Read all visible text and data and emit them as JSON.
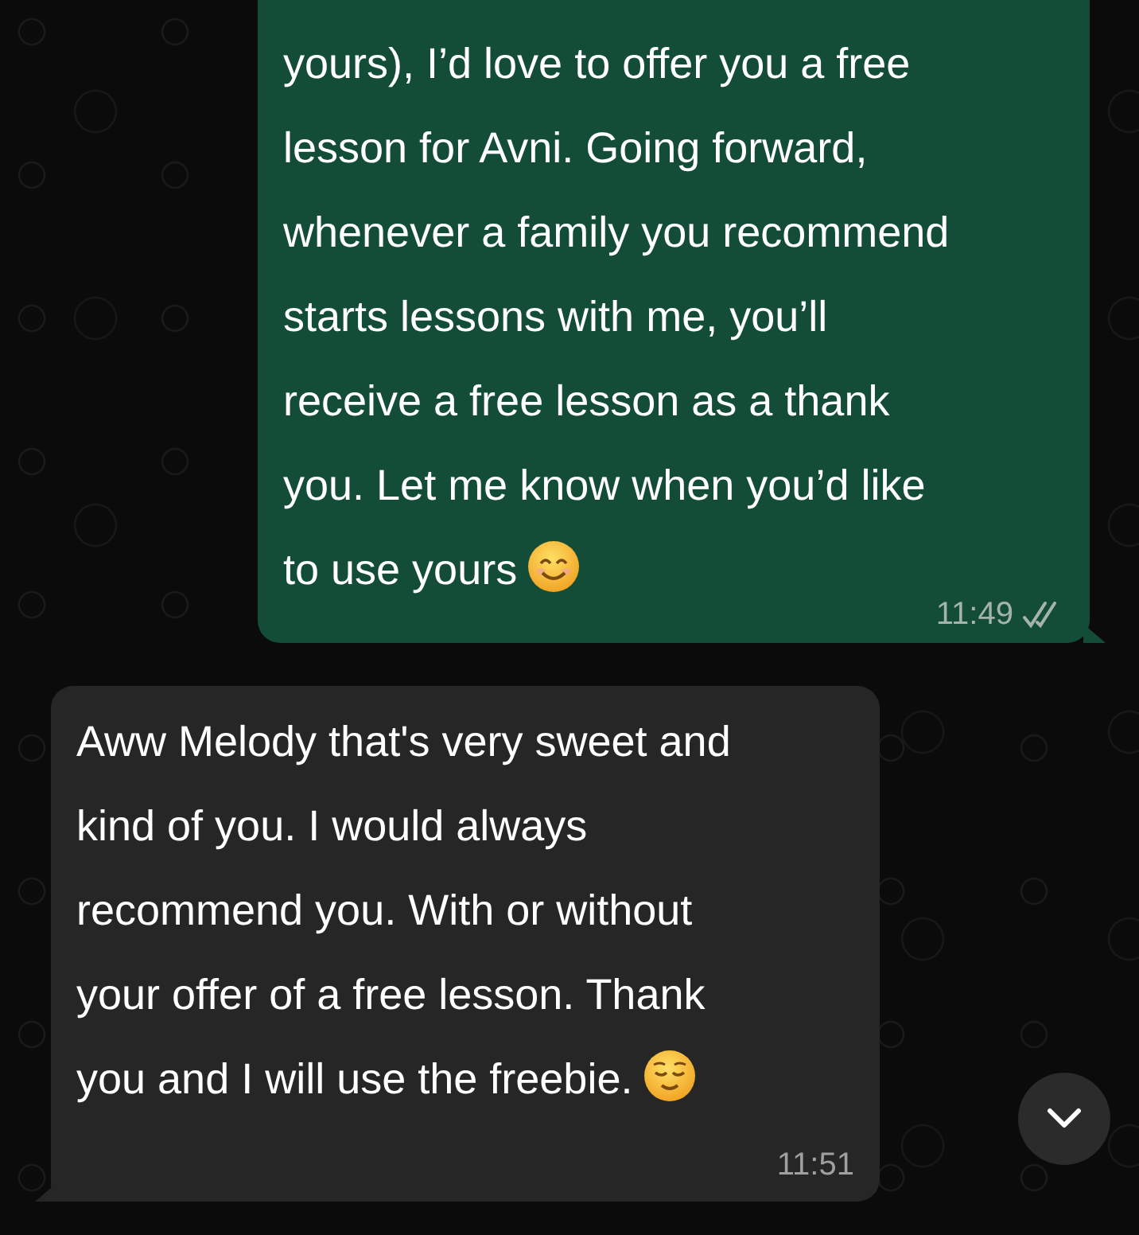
{
  "messages": [
    {
      "kind": "outgoing",
      "lines": [
        "yours), I’d love to offer you a free",
        "lesson for Avni. Going forward,",
        "whenever a family you recommend",
        "starts lessons with me, you’ll",
        "receive a free lesson as a thank",
        "you. Let me know when you’d like",
        "to use yours"
      ],
      "emoji": {
        "kind": "smiling_eyes"
      },
      "time": "11:49",
      "delivered": true,
      "read": false
    },
    {
      "kind": "incoming",
      "lines": [
        "Aww Melody that's very sweet and",
        "kind of you. I would always",
        "recommend you. With or without",
        "your offer of a free lesson. Thank",
        "you and I will use the freebie."
      ],
      "emoji": {
        "kind": "relieved"
      },
      "time": "11:51"
    }
  ],
  "scroll_down_button": true
}
